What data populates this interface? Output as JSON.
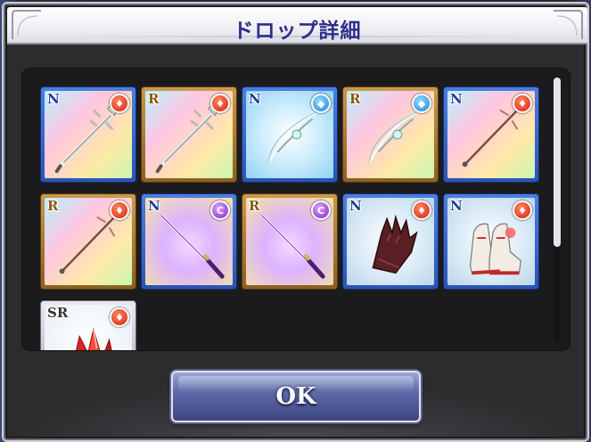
{
  "dialog": {
    "title": "ドロップ詳細",
    "ok_label": "OK"
  },
  "items": [
    {
      "rarity": "N",
      "element": "fire",
      "element_icon": "fire-icon",
      "kind": "spear",
      "bg": "rainbow"
    },
    {
      "rarity": "R",
      "element": "fire",
      "element_icon": "fire-icon",
      "kind": "spear",
      "bg": "rainbow"
    },
    {
      "rarity": "N",
      "element": "water",
      "element_icon": "water-icon",
      "kind": "bow",
      "bg": "ice"
    },
    {
      "rarity": "R",
      "element": "water",
      "element_icon": "water-icon",
      "kind": "bow",
      "bg": "rainbow"
    },
    {
      "rarity": "N",
      "element": "fire",
      "element_icon": "fire-icon",
      "kind": "lance",
      "bg": "rainbow"
    },
    {
      "rarity": "R",
      "element": "fire",
      "element_icon": "fire-icon",
      "kind": "lance",
      "bg": "rainbow"
    },
    {
      "rarity": "N",
      "element": "dark",
      "element_icon": "dark-icon",
      "kind": "katana",
      "bg": "purple"
    },
    {
      "rarity": "R",
      "element": "dark",
      "element_icon": "dark-icon",
      "kind": "katana",
      "bg": "purple"
    },
    {
      "rarity": "N",
      "element": "fire",
      "element_icon": "fire-icon",
      "kind": "gloves",
      "bg": "plain"
    },
    {
      "rarity": "N",
      "element": "fire",
      "element_icon": "fire-icon",
      "kind": "boots",
      "bg": "plain"
    },
    {
      "rarity": "SR",
      "element": "fire",
      "element_icon": "fire-icon",
      "kind": "crystal",
      "bg": "red"
    }
  ],
  "colors": {
    "title_text": "#2d2e8c",
    "panel_bg": "#1b1b1d",
    "frame_N": "#2a54b5",
    "frame_R": "#8a6022",
    "frame_SR": "#a8a8b4",
    "fire": "#d81d14",
    "water": "#1f7fe0",
    "dark": "#7d24c8"
  }
}
